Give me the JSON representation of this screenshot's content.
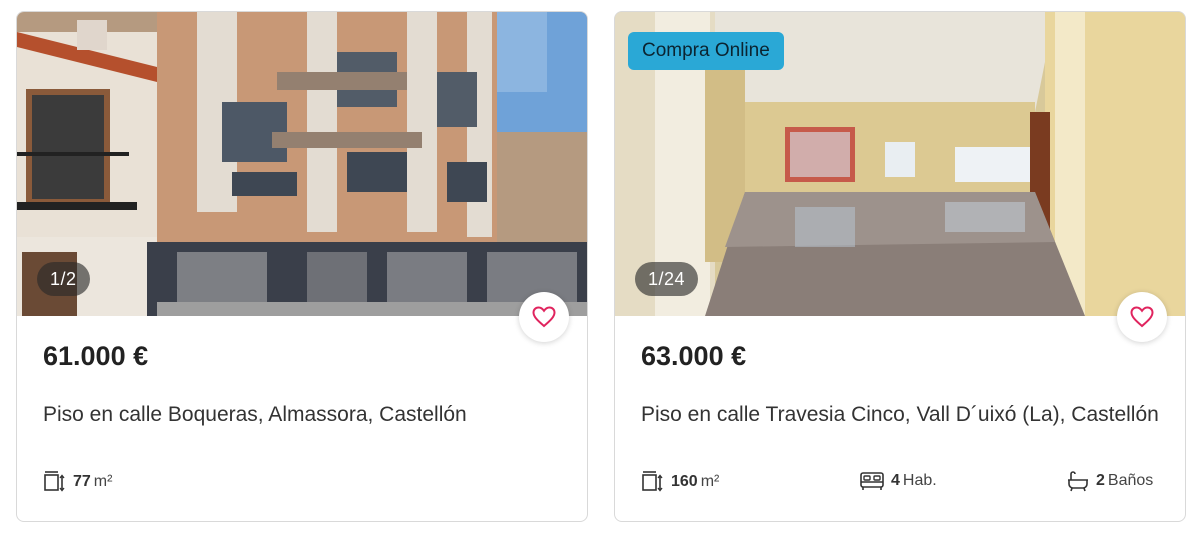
{
  "listings": [
    {
      "photo_counter": "1/2",
      "price": "61.000 €",
      "title": "Piso en calle Boqueras, Almassora, Castellón",
      "area_value": "77",
      "area_unit": "m²",
      "photo_icon": "building-facade-photo",
      "favorite_icon": "heart-icon",
      "area_icon": "floor-area-icon"
    },
    {
      "badge": "Compra Online",
      "photo_counter": "1/24",
      "price": "63.000 €",
      "title": "Piso en calle Travesia Cinco, Vall D´uixó (La), Castellón",
      "area_value": "160",
      "area_unit": "m²",
      "rooms_value": "4",
      "rooms_unit": "Hab.",
      "baths_value": "2",
      "baths_unit": "Baños",
      "photo_icon": "empty-living-room-photo",
      "favorite_icon": "heart-icon",
      "area_icon": "floor-area-icon",
      "rooms_icon": "bed-icon",
      "baths_icon": "bathtub-icon"
    }
  ],
  "colors": {
    "badge_bg": "#2aa8d6",
    "heart": "#e0245e",
    "counter_bg": "rgba(40,40,40,0.62)"
  }
}
